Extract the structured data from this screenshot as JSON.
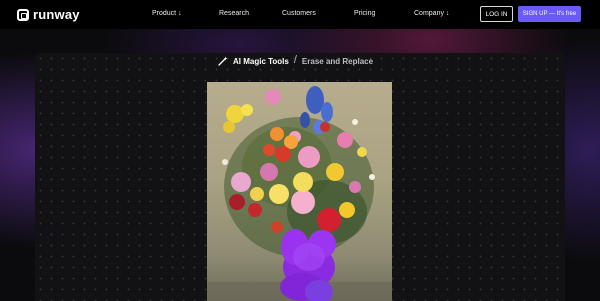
{
  "brand": {
    "name": "runway"
  },
  "nav": {
    "links": [
      {
        "label": "Product ↓"
      },
      {
        "label": "Research"
      },
      {
        "label": "Customers"
      },
      {
        "label": "Pricing"
      },
      {
        "label": "Company ↓"
      }
    ],
    "login_label": "LOG IN",
    "signup_label": "SIGN UP — It's free"
  },
  "breadcrumb": {
    "section": "AI Magic Tools",
    "separator": "/",
    "current": "Erase and Replace"
  },
  "colors": {
    "accent": "#6a5af7",
    "nav_bg": "#000000",
    "panel_bg": "#121214",
    "mask_purple": "#8a2be2"
  },
  "icons": {
    "logo": "runway-logo-icon",
    "tool": "magic-wand-icon"
  }
}
